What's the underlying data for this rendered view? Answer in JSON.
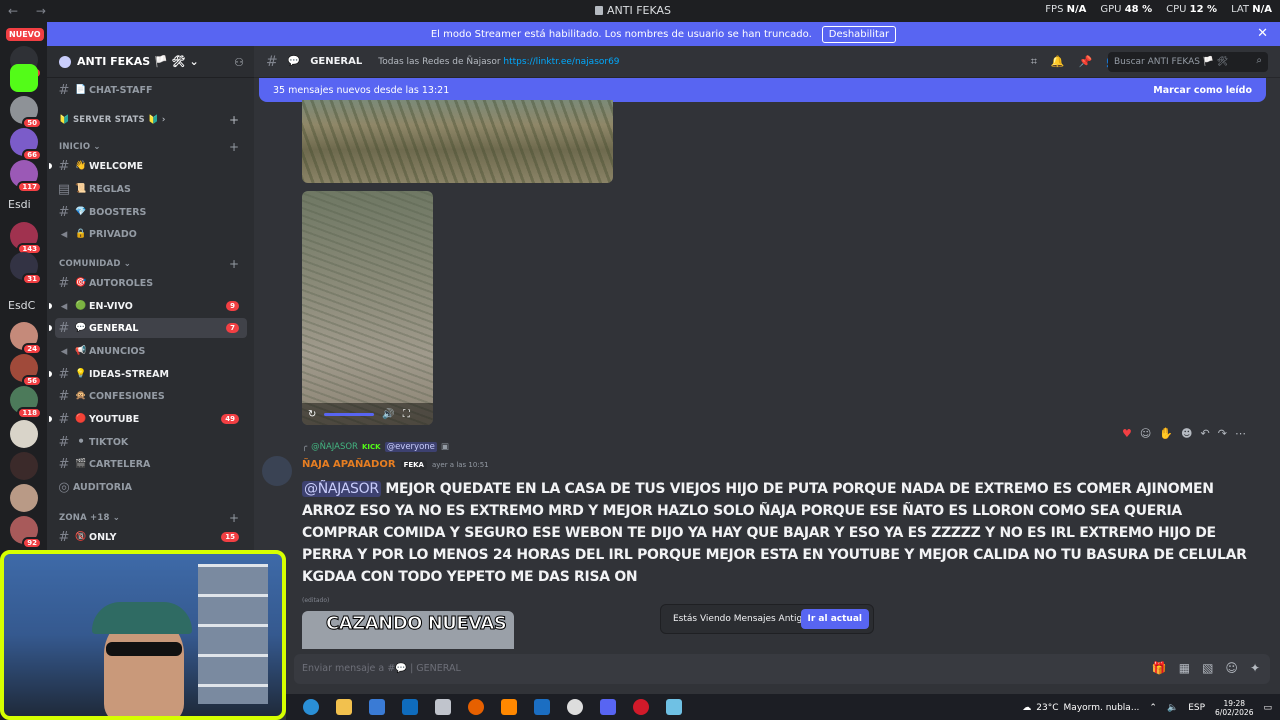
{
  "window": {
    "back": "←",
    "forward": "→",
    "title": "ANTI FEKAS",
    "stats": [
      {
        "label": "FPS",
        "value": "N/A"
      },
      {
        "label": "GPU",
        "value": "48 %"
      },
      {
        "label": "CPU",
        "value": "12 %"
      },
      {
        "label": "LAT",
        "value": "N/A"
      }
    ]
  },
  "banner": {
    "text": "El modo Streamer está habilitado. Los nombres de usuario se han truncado.",
    "button": "Deshabilitar",
    "close": "✕"
  },
  "rail": {
    "new_badge": "NUEVO",
    "servers": [
      {
        "badge": "198"
      },
      {
        "badge": ""
      },
      {
        "badge": "50"
      },
      {
        "badge": "66"
      },
      {
        "badge": "117"
      },
      {
        "label": "Esdi"
      },
      {
        "badge": "143"
      },
      {
        "badge": "31"
      },
      {
        "label": "EsdC"
      },
      {
        "badge": "24"
      },
      {
        "badge": "56"
      },
      {
        "badge": "118"
      },
      {
        "badge": ""
      },
      {
        "badge": ""
      },
      {
        "badge": ""
      },
      {
        "badge": "92"
      }
    ]
  },
  "sidebar": {
    "server_name": "ANTI FEKAS 🏳️ 🛠",
    "channels_top": [
      {
        "name": "CHAT-STAFF",
        "emoji": "📄"
      }
    ],
    "categories": {
      "server_stats": "🔰 SERVER STATS 🔰",
      "inicio": "INICIO",
      "comunidad": "COMUNIDAD",
      "zona": "ZONA +18"
    },
    "inicio_channels": [
      {
        "name": "WELCOME",
        "emoji": "👋",
        "unread": true
      },
      {
        "name": "REGLAS",
        "emoji": "📜"
      },
      {
        "name": "BOOSTERS",
        "emoji": "💎"
      },
      {
        "name": "PRIVADO",
        "emoji": "🔒"
      }
    ],
    "comunidad_channels": [
      {
        "name": "AUTOROLES",
        "emoji": "🎯"
      },
      {
        "name": "EN-VIVO",
        "emoji": "🟢",
        "unread": true,
        "count": "9"
      },
      {
        "name": "GENERAL",
        "emoji": "💬",
        "active": true,
        "count": "7"
      },
      {
        "name": "ANUNCIOS",
        "emoji": "📢"
      },
      {
        "name": "IDEAS-STREAM",
        "emoji": "💡",
        "unread": true
      },
      {
        "name": "CONFESIONES",
        "emoji": "🙊"
      },
      {
        "name": "YOUTUBE",
        "emoji": "🔴",
        "unread": true,
        "count": "49"
      },
      {
        "name": "TIKTOK",
        "emoji": "⚫"
      },
      {
        "name": "CARTELERA",
        "emoji": "🎬"
      },
      {
        "name": "AUDITORIA",
        "emoji": ""
      }
    ],
    "zona_channels": [
      {
        "name": "ONLY",
        "emoji": "🔞",
        "unread": true,
        "count": "15"
      }
    ]
  },
  "channel_header": {
    "name": "GENERAL",
    "topic": "Todas las Redes de Ñajasor",
    "link": "https://linktr.ee/najasor69",
    "search_placeholder": "Buscar ANTI FEKAS 🏳️ 🛠"
  },
  "new_messages_bar": {
    "text": "35 mensajes nuevos desde las 13:21",
    "action": "Marcar como leído"
  },
  "message": {
    "reply_name": "@ÑAJASOR",
    "reply_badge": "KICK",
    "reply_mention": "@everyone",
    "author": "ÑAJA APAÑADOR",
    "tag": "FEKA",
    "time": "ayer a las 10:51",
    "mention": "@ÑAJASOR",
    "text": " MEJOR QUEDATE EN LA CASA DE TUS VIEJOS HIJO DE PUTA PORQUE NADA DE EXTREMO ES COMER AJINOMEN ARROZ ESO YA NO ES EXTREMO MRD Y MEJOR HAZLO SOLO ÑAJA  PORQUE ESE ÑATO ES LLORON COMO SEA QUERIA COMPRAR COMIDA Y SEGURO ESE WEBON TE DIJO YA HAY QUE BAJAR Y ESO YA ES ZZZZZ Y NO ES IRL EXTREMO HIJO DE PERRA Y POR LO MENOS 24 HORAS DEL IRL PORQUE MEJOR ESTA EN YOUTUBE Y MEJOR CALIDA NO TU BASURA DE CELULAR KGDAA CON TODO YEPETO ME DAS RISA ON",
    "edited": "(editado)",
    "image_caption": "CAZANDO NUEVAS"
  },
  "old_messages": {
    "text": "Estás Viendo Mensajes Antiguos",
    "button": "Ir al actual"
  },
  "composer": {
    "placeholder": "Enviar mensaje a #💬 | GENERAL"
  },
  "taskbar": {
    "temperature": "23°C",
    "weather": "Mayorm. nubla...",
    "lang": "ESP",
    "time": "19:28",
    "date": "6/02/2026"
  },
  "colors": {
    "accent": "#5865f2",
    "webcam_border": "#d6ff00",
    "mention_bg": "#3c4270",
    "author": "#e67e22"
  }
}
